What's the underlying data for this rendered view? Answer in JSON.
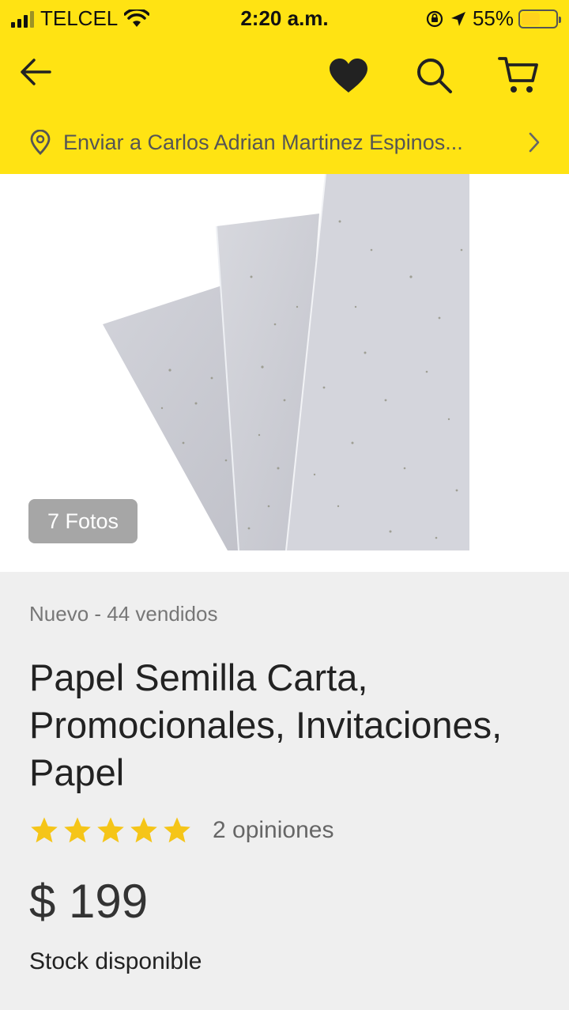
{
  "status_bar": {
    "carrier": "TELCEL",
    "time": "2:20 a.m.",
    "battery": "55%",
    "battery_level": 0.55
  },
  "header": {
    "icons": [
      "back-arrow-icon",
      "heart-icon",
      "search-icon",
      "cart-icon"
    ],
    "address": "Enviar a Carlos Adrian Martinez Espinos..."
  },
  "gallery": {
    "photos_badge": "7 Fotos"
  },
  "product": {
    "condition": "Nuevo - 44 vendidos",
    "title": "Papel Semilla Carta, Promocionales, Invitaciones, Papel",
    "rating": 5,
    "reviews": "2 opiniones",
    "price": "$ 199",
    "stock": "Stock disponible"
  },
  "colors": {
    "brand_yellow": "#ffe313",
    "star": "#f5c518"
  }
}
